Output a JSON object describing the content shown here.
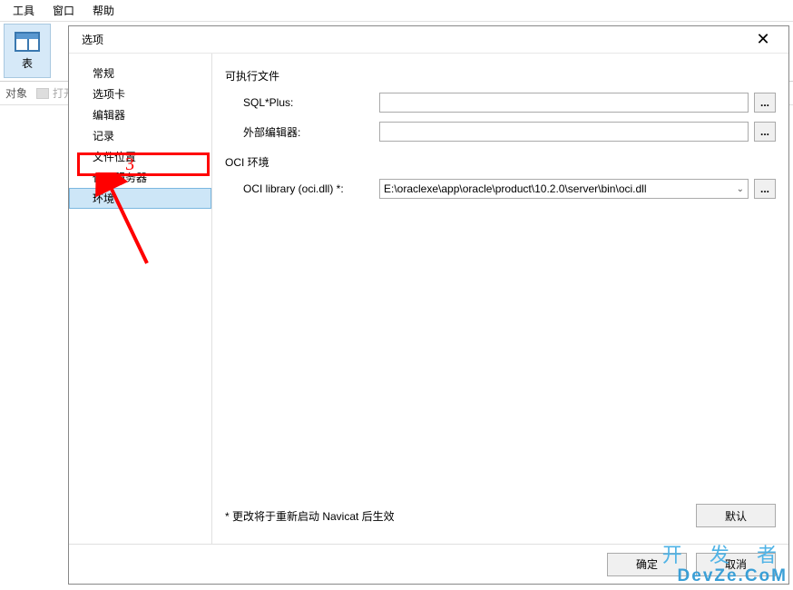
{
  "menubar": {
    "tools": "工具",
    "window": "窗口",
    "help": "帮助"
  },
  "ribbon": {
    "table_btn": "表"
  },
  "sub_toolbar": {
    "object": "对象",
    "open_table": "打开表"
  },
  "dialog": {
    "title": "选项",
    "sidebar": {
      "items": [
        {
          "label": "常规"
        },
        {
          "label": "选项卡"
        },
        {
          "label": "编辑器"
        },
        {
          "label": "记录"
        },
        {
          "label": "文件位置"
        },
        {
          "label": "代理服务器"
        },
        {
          "label": "环境",
          "selected": true
        }
      ]
    },
    "content": {
      "section1_title": "可执行文件",
      "sqlplus_label": "SQL*Plus:",
      "sqlplus_value": "",
      "ext_editor_label": "外部编辑器:",
      "ext_editor_value": "",
      "section2_title": "OCI 环境",
      "oci_library_label": "OCI library (oci.dll) *:",
      "oci_library_value": "E:\\oraclexe\\app\\oracle\\product\\10.2.0\\server\\bin\\oci.dll",
      "browse_btn": "...",
      "footer_note": "* 更改将于重新启动 Navicat 后生效",
      "default_btn": "默认"
    },
    "buttons": {
      "ok": "确定",
      "cancel": "取消"
    }
  },
  "annotation": {
    "number": "3"
  },
  "watermark": {
    "line1": "开 发 者",
    "line2": "DevZe.CoM"
  }
}
